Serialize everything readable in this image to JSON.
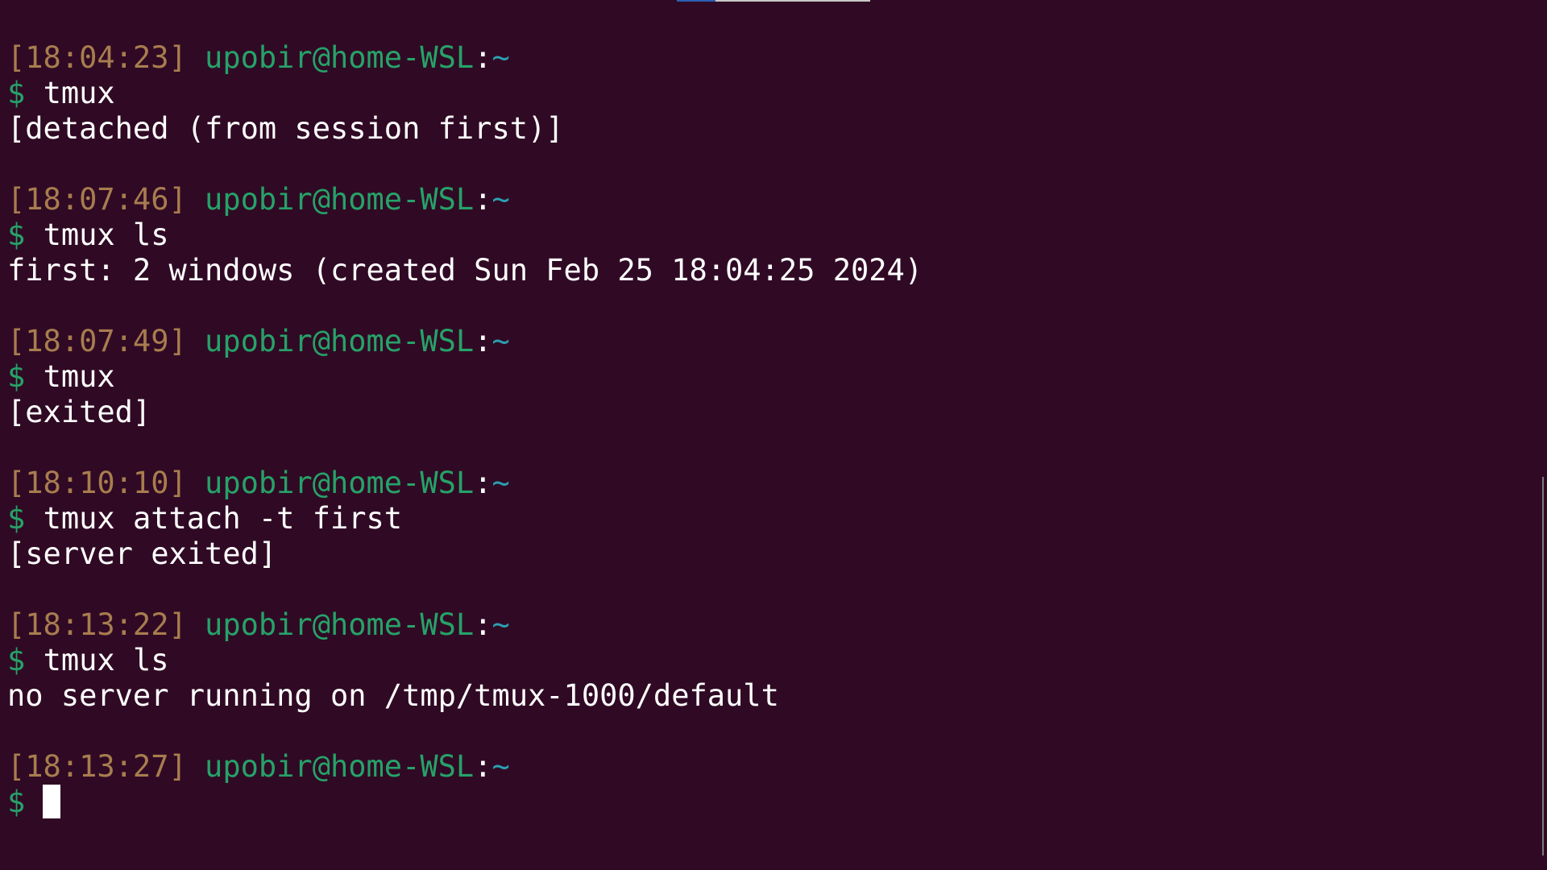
{
  "theme": {
    "background": "#300a24",
    "timestamp_color": "#a87d4f",
    "userhost_color": "#26a269",
    "path_color": "#2aa1b3",
    "text_color": "#ffffff"
  },
  "entries": [
    {
      "timestamp": "[18:04:23]",
      "userhost": "upobir@home-WSL",
      "colon": ":",
      "path": "~",
      "prompt": "$",
      "command": "tmux",
      "output": "[detached (from session first)]"
    },
    {
      "timestamp": "[18:07:46]",
      "userhost": "upobir@home-WSL",
      "colon": ":",
      "path": "~",
      "prompt": "$",
      "command": "tmux ls",
      "output": "first: 2 windows (created Sun Feb 25 18:04:25 2024)"
    },
    {
      "timestamp": "[18:07:49]",
      "userhost": "upobir@home-WSL",
      "colon": ":",
      "path": "~",
      "prompt": "$",
      "command": "tmux",
      "output": "[exited]"
    },
    {
      "timestamp": "[18:10:10]",
      "userhost": "upobir@home-WSL",
      "colon": ":",
      "path": "~",
      "prompt": "$",
      "command": "tmux attach -t first",
      "output": "[server exited]"
    },
    {
      "timestamp": "[18:13:22]",
      "userhost": "upobir@home-WSL",
      "colon": ":",
      "path": "~",
      "prompt": "$",
      "command": "tmux ls",
      "output": "no server running on /tmp/tmux-1000/default"
    }
  ],
  "current": {
    "timestamp": "[18:13:27]",
    "userhost": "upobir@home-WSL",
    "colon": ":",
    "path": "~",
    "prompt": "$",
    "input": ""
  }
}
